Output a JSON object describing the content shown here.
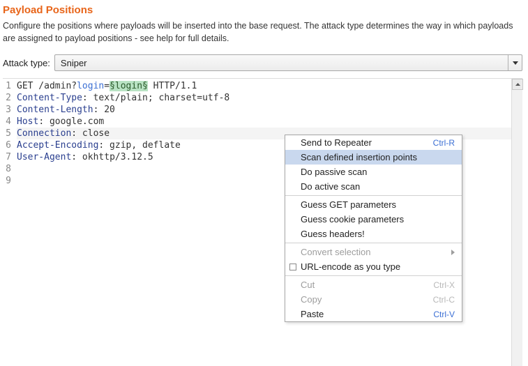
{
  "section": {
    "title": "Payload Positions",
    "description": "Configure the positions where payloads will be inserted into the base request. The attack type determines the way in which payloads are assigned to payload positions - see help for full details."
  },
  "attack": {
    "label": "Attack type:",
    "value": "Sniper"
  },
  "editor": {
    "lines": [
      {
        "n": "1",
        "segments": [
          {
            "t": "GET /admin?",
            "c": ""
          },
          {
            "t": "login",
            "c": "param"
          },
          {
            "t": "=",
            "c": ""
          },
          {
            "t": "§login§",
            "c": "marker"
          },
          {
            "t": " HTTP/1.1",
            "c": ""
          }
        ]
      },
      {
        "n": "2",
        "segments": [
          {
            "t": "Content-Type",
            "c": "header"
          },
          {
            "t": ": text/plain; charset=utf-8",
            "c": ""
          }
        ]
      },
      {
        "n": "3",
        "segments": [
          {
            "t": "Content-Length",
            "c": "header"
          },
          {
            "t": ": 20",
            "c": ""
          }
        ]
      },
      {
        "n": "4",
        "segments": [
          {
            "t": "Host",
            "c": "header"
          },
          {
            "t": ": google.com",
            "c": ""
          }
        ]
      },
      {
        "n": "5",
        "segments": [
          {
            "t": "Connection",
            "c": "header"
          },
          {
            "t": ": close",
            "c": ""
          }
        ],
        "highlight": true
      },
      {
        "n": "6",
        "segments": [
          {
            "t": "Accept-Encoding",
            "c": "header"
          },
          {
            "t": ": gzip, deflate",
            "c": ""
          }
        ]
      },
      {
        "n": "7",
        "segments": [
          {
            "t": "User-Agent",
            "c": "header"
          },
          {
            "t": ": okhttp/3.12.5",
            "c": ""
          }
        ]
      },
      {
        "n": "8",
        "segments": [
          {
            "t": "",
            "c": ""
          }
        ]
      },
      {
        "n": "9",
        "segments": [
          {
            "t": "",
            "c": ""
          }
        ]
      }
    ]
  },
  "menu": [
    {
      "type": "item",
      "label": "Send to Repeater",
      "shortcut": "Ctrl-R"
    },
    {
      "type": "item",
      "label": "Scan defined insertion points",
      "highlight": true
    },
    {
      "type": "item",
      "label": "Do passive scan"
    },
    {
      "type": "item",
      "label": "Do active scan"
    },
    {
      "type": "sep"
    },
    {
      "type": "item",
      "label": "Guess GET parameters"
    },
    {
      "type": "item",
      "label": "Guess cookie parameters"
    },
    {
      "type": "item",
      "label": "Guess headers!"
    },
    {
      "type": "sep"
    },
    {
      "type": "item",
      "label": "Convert selection",
      "disabled": true,
      "submenu": true
    },
    {
      "type": "item",
      "label": "URL-encode as you type",
      "checkbox": true
    },
    {
      "type": "sep"
    },
    {
      "type": "item",
      "label": "Cut",
      "shortcut": "Ctrl-X",
      "disabled": true
    },
    {
      "type": "item",
      "label": "Copy",
      "shortcut": "Ctrl-C",
      "disabled": true
    },
    {
      "type": "item",
      "label": "Paste",
      "shortcut": "Ctrl-V"
    }
  ]
}
